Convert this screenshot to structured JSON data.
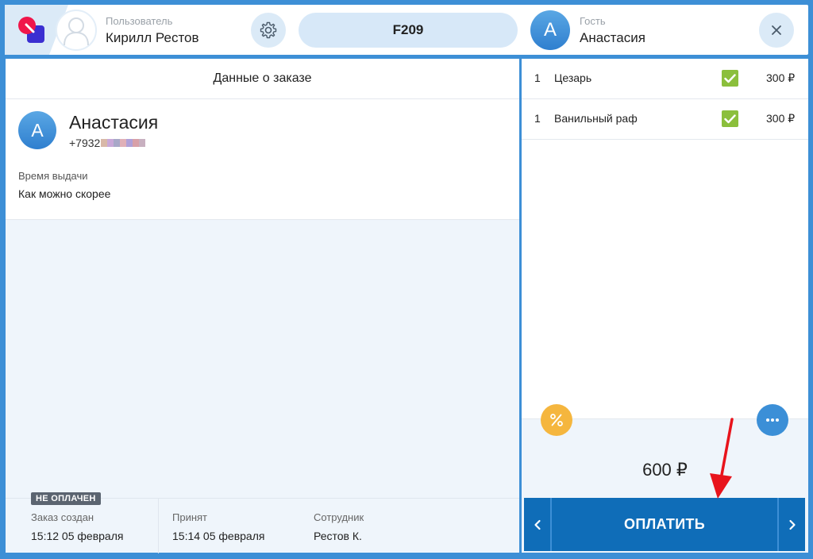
{
  "header": {
    "user_caption": "Пользователь",
    "user_name": "Кирилл Рестов",
    "table_code": "F209",
    "guest_initial": "А",
    "guest_caption": "Гость",
    "guest_name": "Анастасия",
    "icons": [
      "app-logo-icon",
      "user-placeholder-icon",
      "gear-icon",
      "close-icon"
    ]
  },
  "order": {
    "title": "Данные о заказе",
    "customer": {
      "initial": "А",
      "name": "Анастасия",
      "phone_prefix": "+7932"
    },
    "pickup_label": "Время выдачи",
    "pickup_value": "Как можно скорее",
    "status_badge": "НЕ ОПЛАЧЕН",
    "footer": [
      {
        "label": "Заказ создан",
        "value": "15:12 05 февраля"
      },
      {
        "label": "Принят",
        "value": "15:14 05 февраля"
      },
      {
        "label": "Сотрудник",
        "value": "Рестов К."
      }
    ]
  },
  "items": [
    {
      "qty": "1",
      "name": "Цезарь",
      "checked": true,
      "price": "300 ₽"
    },
    {
      "qty": "1",
      "name": "Ванильный раф",
      "checked": true,
      "price": "300 ₽"
    }
  ],
  "summary": {
    "total": "600 ₽",
    "pay_label": "ОПЛАТИТЬ",
    "icons": [
      "percent-icon",
      "more-dots-icon",
      "chevron-left-icon",
      "chevron-right-icon"
    ]
  },
  "colors": {
    "accent_blue": "#3d8fd6",
    "pay_button": "#0f6db8",
    "check_green": "#8bbf3c",
    "discount_orange": "#f5b63e",
    "annotation_red": "#e8141c"
  }
}
